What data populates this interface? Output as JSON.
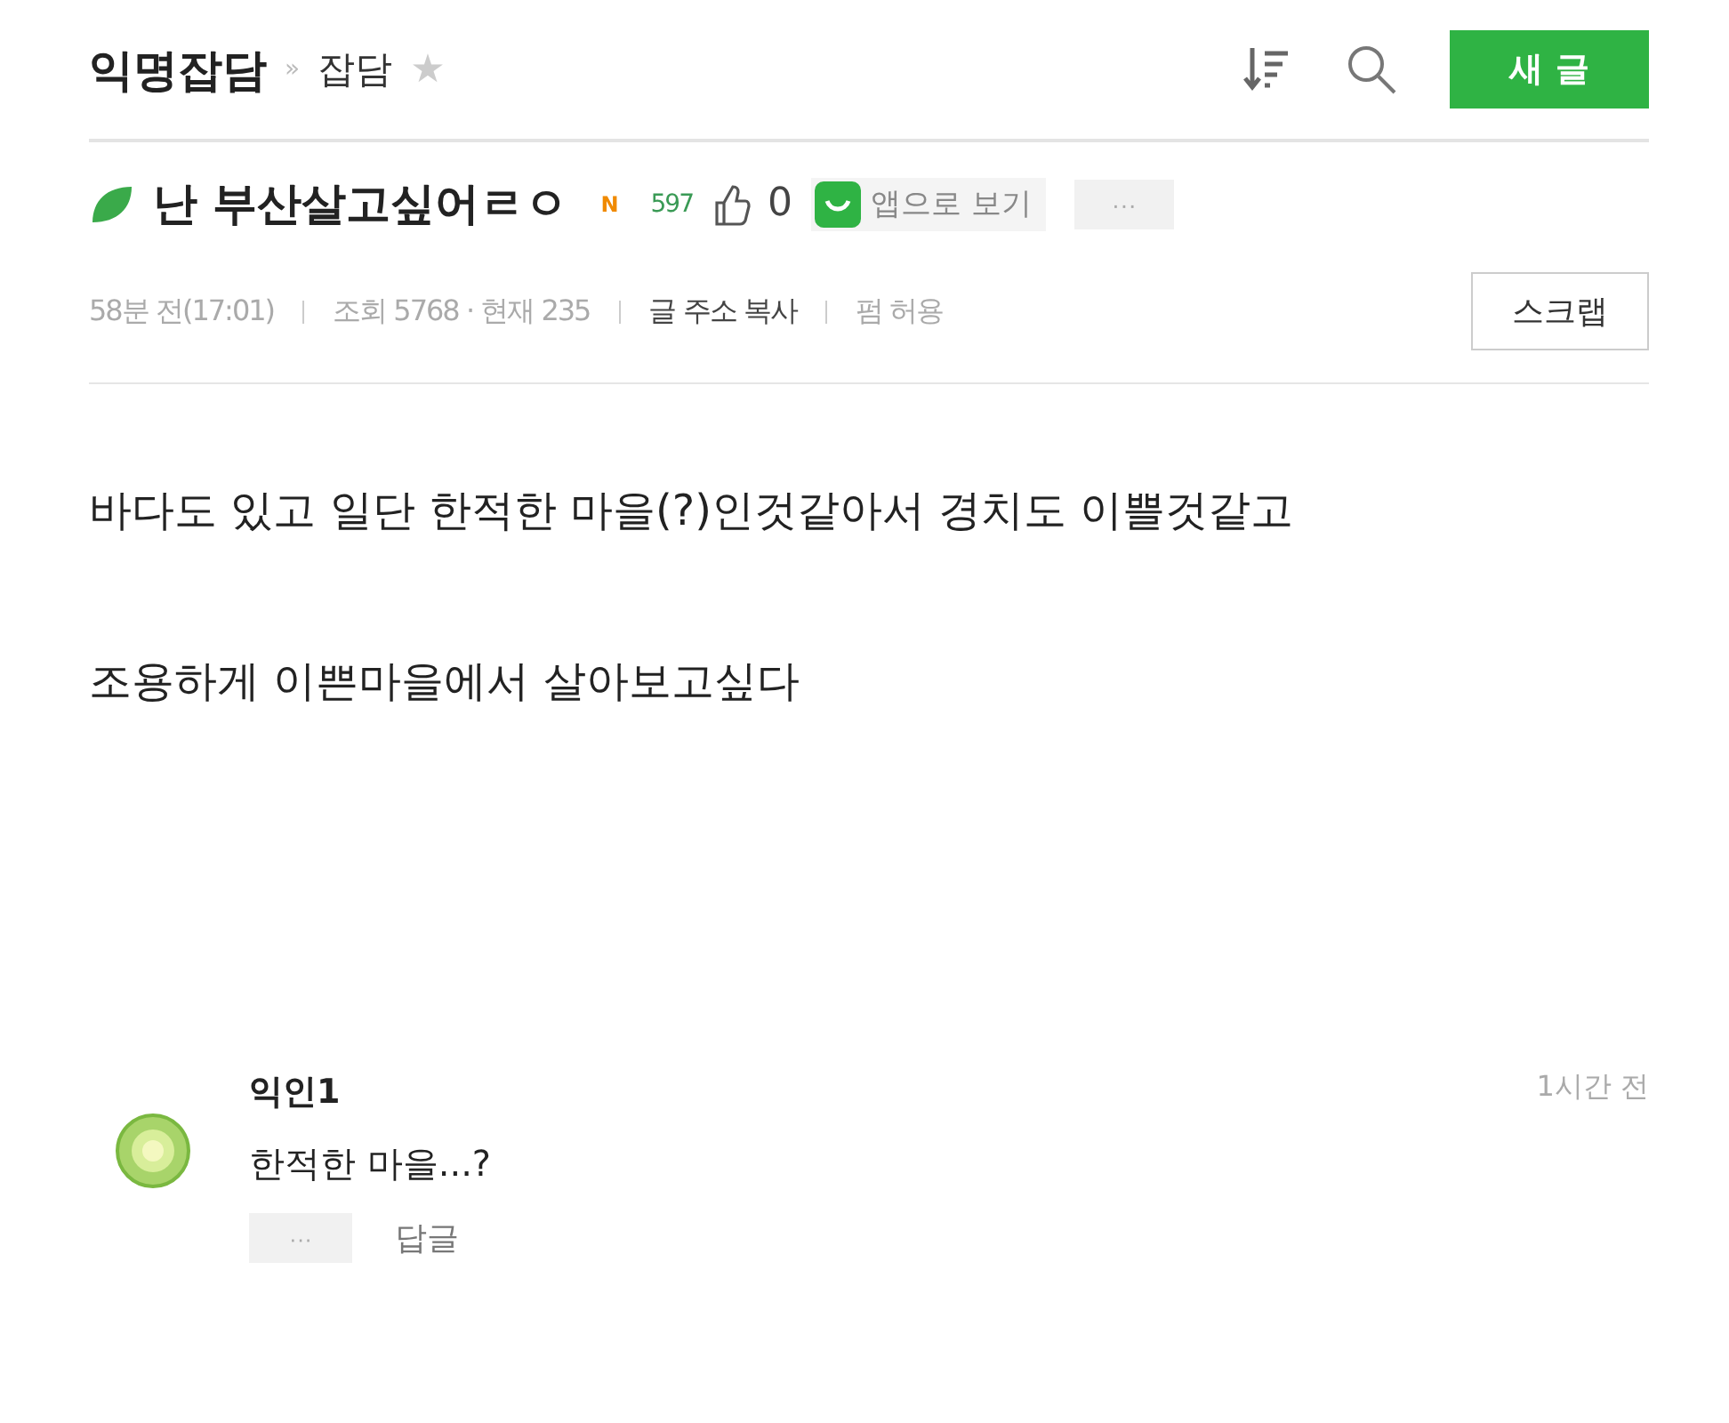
{
  "header": {
    "board": "익명잡담",
    "separator": "»",
    "category": "잡담",
    "star": "★",
    "new_post_button": "새 글"
  },
  "post": {
    "title": "난 부산살고싶어ㄹㅇ",
    "new_badge": "N",
    "level": "597",
    "likes": "0",
    "app_button": "앱으로 보기",
    "more": "···",
    "meta": [
      "58분 전(17:01)",
      "조회 5768 · 현재 235",
      "글 주소 복사",
      "펌 허용"
    ],
    "scrap_button": "스크랩",
    "body": [
      "바다도 있고 일단 한적한 마을(?)인것같아서 경치도 이쁠것같고",
      "조용하게 이쁜마을에서 살아보고싶다"
    ]
  },
  "comments": [
    {
      "author": "익인1",
      "time": "1시간 전",
      "text": "한적한 마을...?",
      "more": "···",
      "reply": "답글"
    }
  ]
}
